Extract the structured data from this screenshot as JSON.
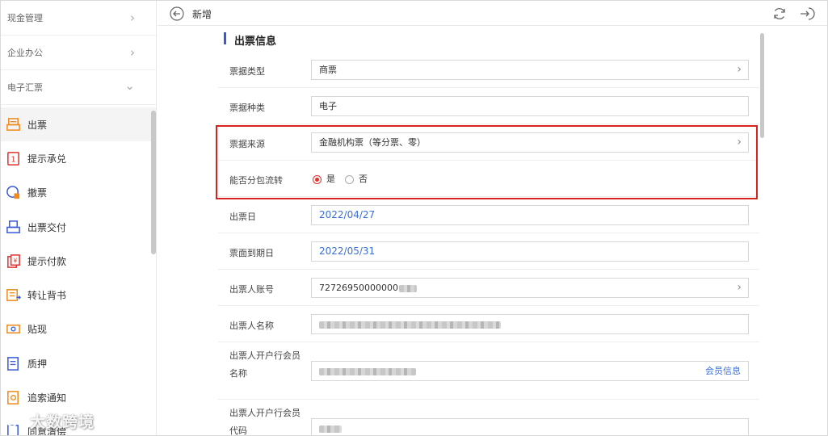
{
  "sidebar": {
    "groups": [
      {
        "label": "现金管理",
        "expanded": false
      },
      {
        "label": "企业办公",
        "expanded": false
      },
      {
        "label": "电子汇票",
        "expanded": true
      }
    ],
    "items": [
      {
        "label": "出票",
        "icon": "issue-bill-icon",
        "active": true
      },
      {
        "label": "提示承兑",
        "icon": "acceptance-prompt-icon",
        "active": false
      },
      {
        "label": "撤票",
        "icon": "cancel-bill-icon",
        "active": false
      },
      {
        "label": "出票交付",
        "icon": "issue-delivery-icon",
        "active": false
      },
      {
        "label": "提示付款",
        "icon": "payment-prompt-icon",
        "active": false
      },
      {
        "label": "转让背书",
        "icon": "endorsement-icon",
        "active": false
      },
      {
        "label": "贴现",
        "icon": "discount-icon",
        "active": false
      },
      {
        "label": "质押",
        "icon": "pledge-icon",
        "active": false
      },
      {
        "label": "追索通知",
        "icon": "recourse-notice-icon",
        "active": false
      },
      {
        "label": "同意清偿",
        "icon": "agree-settlement-icon",
        "active": false
      }
    ],
    "watermark": "大数跨境"
  },
  "header": {
    "title": "新增"
  },
  "form": {
    "section_title": "出票信息",
    "bill_type": {
      "label": "票据类型",
      "value": "商票"
    },
    "bill_kind": {
      "label": "票据种类",
      "value": "电子"
    },
    "bill_source": {
      "label": "票据来源",
      "value": "金融机构票（等分票、零）"
    },
    "splittable": {
      "label": "能否分包流转",
      "options": [
        "是",
        "否"
      ],
      "selected": "是"
    },
    "issue_date": {
      "label": "出票日",
      "value": "2022/04/27"
    },
    "due_date": {
      "label": "票面到期日",
      "value": "2022/05/31"
    },
    "drawer_account": {
      "label": "出票人账号",
      "value": "72726950000000"
    },
    "drawer_name": {
      "label": "出票人名称"
    },
    "drawer_bank_member_name": {
      "label": "出票人开户行会员名称",
      "link": "会员信息"
    },
    "drawer_bank_member_code": {
      "label": "出票人开户行会员代码"
    }
  },
  "colors": {
    "accent": "#3a59d8",
    "highlight": "#d8231f",
    "link": "#3a6fd8",
    "radio_selected": "#e0322e"
  }
}
